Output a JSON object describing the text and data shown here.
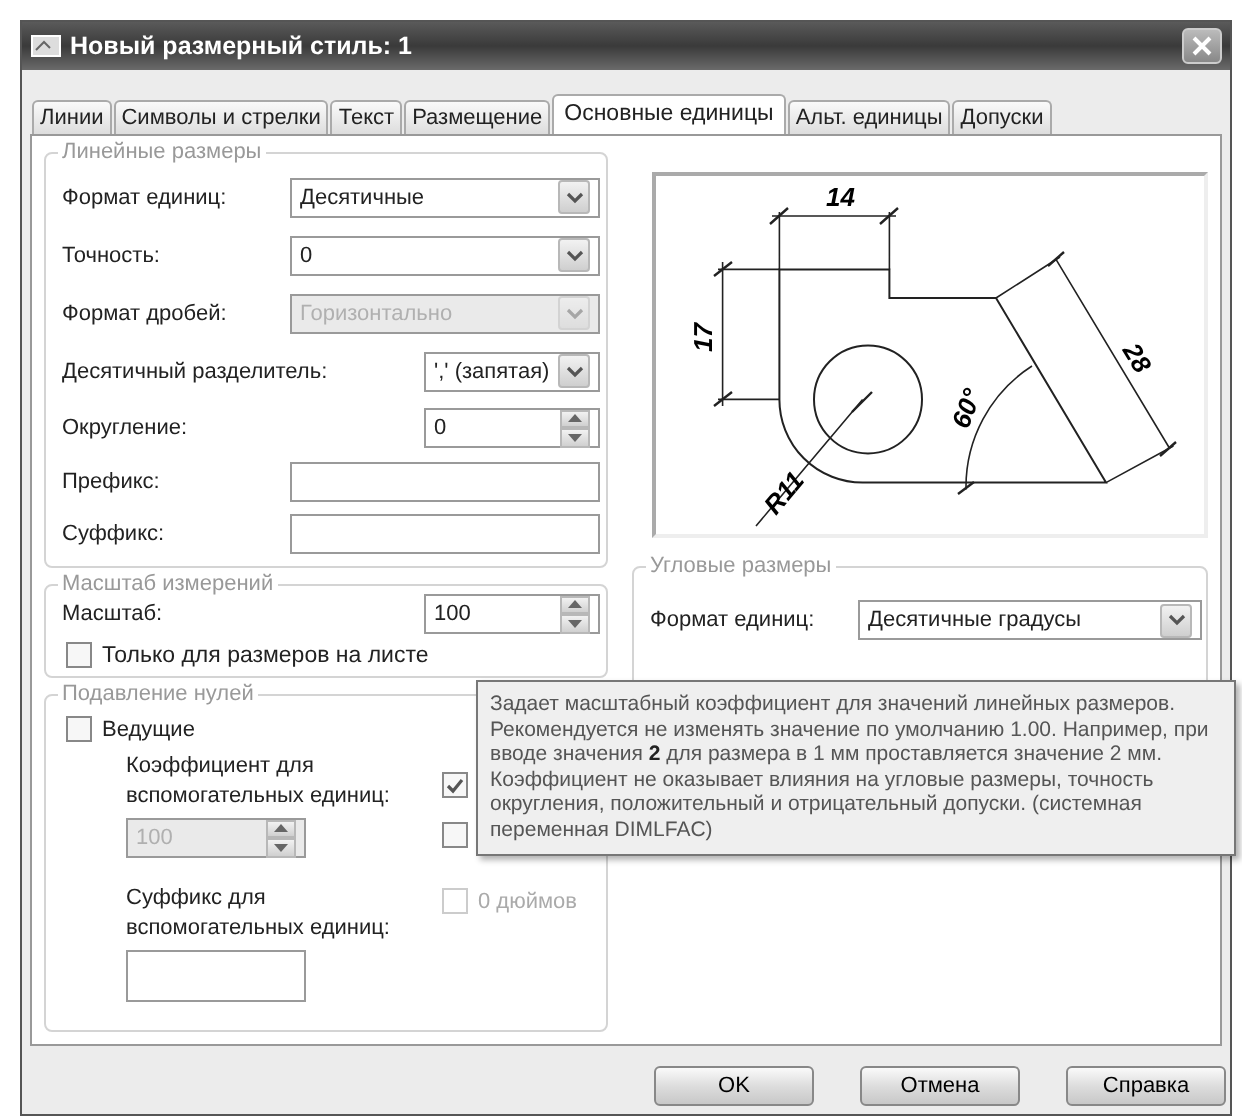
{
  "window": {
    "title": "Новый размерный стиль: 1"
  },
  "tabs": [
    {
      "label": "Линии",
      "selected": false
    },
    {
      "label": "Символы и стрелки",
      "selected": false
    },
    {
      "label": "Текст",
      "selected": false
    },
    {
      "label": "Размещение",
      "selected": false
    },
    {
      "label": "Основные единицы",
      "selected": true
    },
    {
      "label": "Альт. единицы",
      "selected": false
    },
    {
      "label": "Допуски",
      "selected": false
    }
  ],
  "linear_dimensions": {
    "title": "Линейные размеры",
    "fields": [
      {
        "kind": "select",
        "label": "Формат единиц:",
        "value": "Десятичные",
        "disabled": false
      },
      {
        "kind": "select",
        "label": "Точность:",
        "value": "0",
        "disabled": false
      },
      {
        "kind": "select",
        "label": "Формат дробей:",
        "value": "Горизонтально",
        "disabled": true
      },
      {
        "kind": "select",
        "label": "Десятичный разделитель:",
        "value": "',' (запятая)",
        "disabled": false
      },
      {
        "kind": "spinner",
        "label": "Округление:",
        "value": "0",
        "disabled": false
      },
      {
        "kind": "text",
        "label": "Префикс:",
        "disabled": false
      },
      {
        "kind": "text",
        "label": "Суффикс:",
        "disabled": false
      }
    ]
  },
  "measurement_scale": {
    "title": "Масштаб измерений",
    "label": "Масштаб:",
    "value": "100",
    "layout_only": {
      "label": "Только для размеров на листе",
      "checked": false
    }
  },
  "zero_suppression": {
    "title": "Подавление нулей",
    "leading": {
      "label": "Ведущие",
      "checked": false
    },
    "sub_unit_factor": {
      "label": "Коэффициент для вспомогательных единиц:",
      "value": "100",
      "disabled": true
    },
    "sub_unit_suffix": {
      "label": "Суффикс для вспомогательных единиц:"
    },
    "checks": [
      {
        "checked": true,
        "disabled": false
      },
      {
        "checked": false,
        "disabled": false
      },
      {
        "label": "0 дюймов",
        "checked": false,
        "disabled": true
      }
    ]
  },
  "preview": {
    "labels": [
      "14",
      "17",
      "28",
      "60°",
      "R11"
    ]
  },
  "angular_dimensions": {
    "title": "Угловые размеры",
    "label": "Формат единиц:",
    "value": "Десятичные градусы"
  },
  "tooltip": "Задает масштабный коэффициент для значений линейных размеров. Рекомендуется не изменять значение по умолчанию 1.00. Например, при вводе значения **2** для размера в 1 мм проставляется значение 2 мм. Коэффициент не оказывает влияния на угловые размеры, точность округления, положительный и отрицательный допуски. (системная переменная DIMLFAC)",
  "buttons": [
    "OK",
    "Отмена",
    "Справка"
  ]
}
